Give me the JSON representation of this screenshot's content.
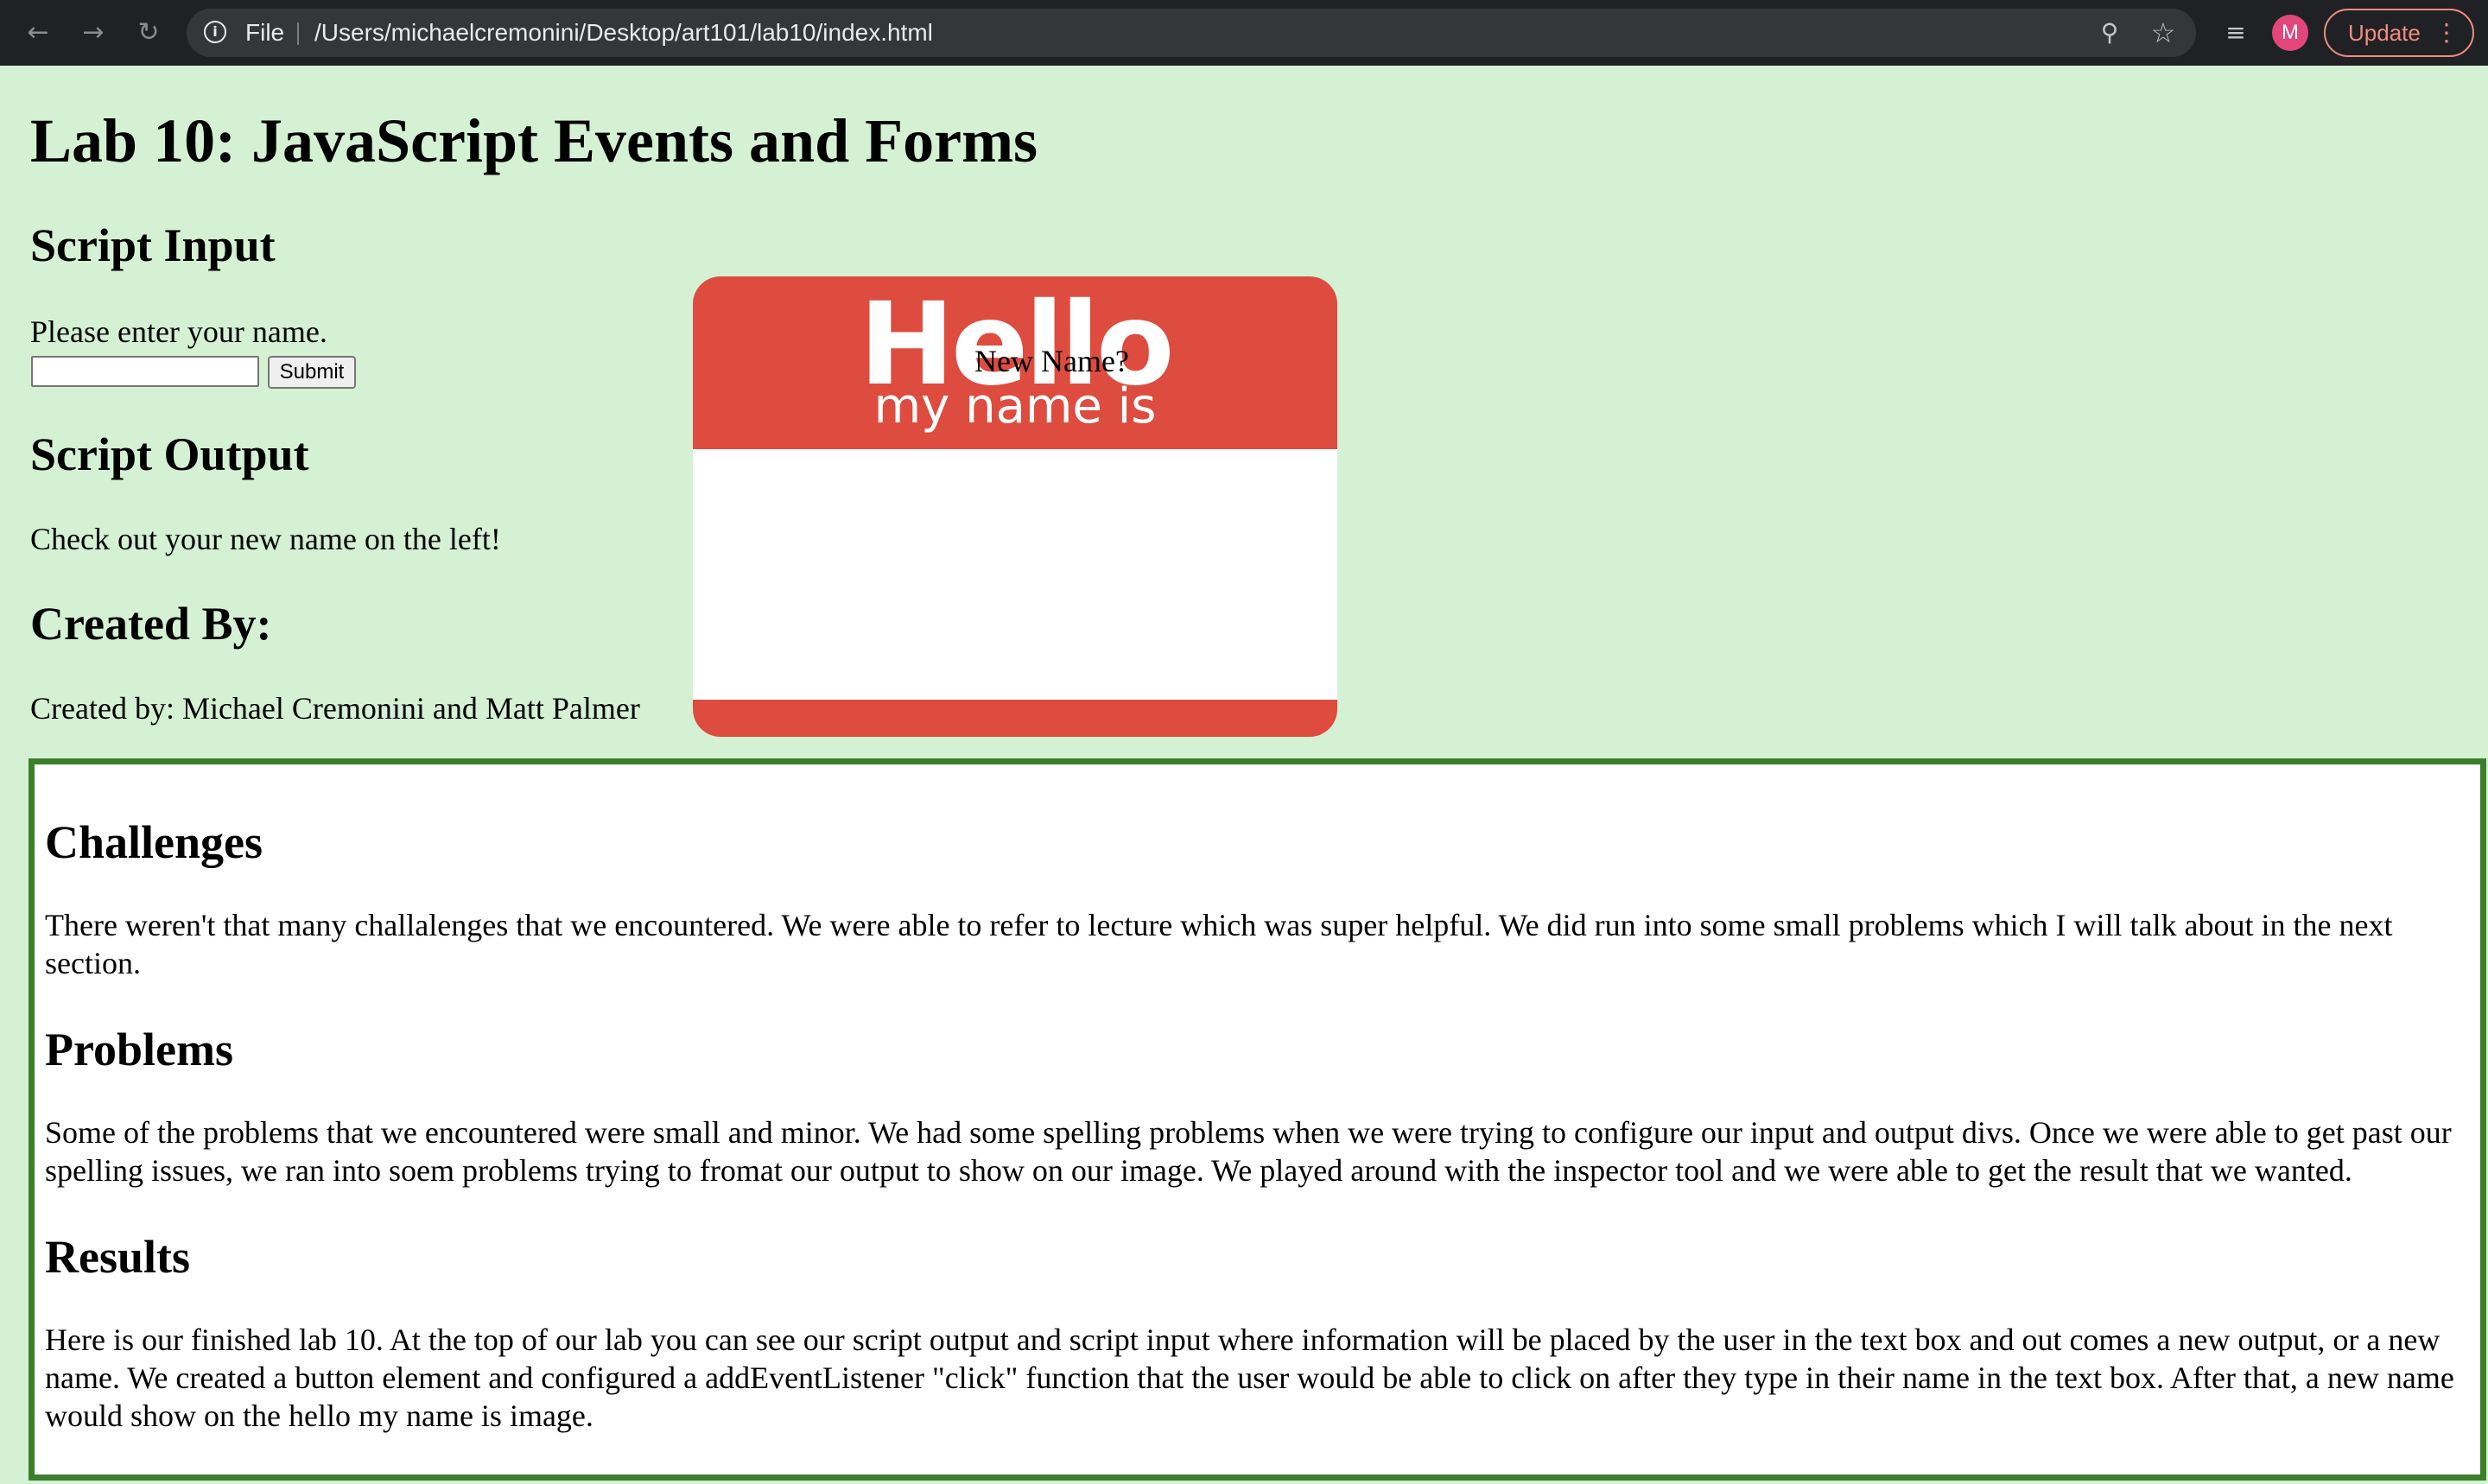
{
  "browser": {
    "scheme": "File",
    "url": "/Users/michaelcremonini/Desktop/art101/lab10/index.html",
    "avatar_letter": "M",
    "update_label": "Update"
  },
  "page": {
    "title": "Lab 10: JavaScript Events and Forms",
    "input_heading": "Script Input",
    "input_prompt": "Please enter your name.",
    "input_value": "",
    "submit_label": "Submit",
    "output_heading": "Script Output",
    "output_text": "Check out your new name on the left!",
    "created_heading": "Created By:",
    "created_text": "Created by: Michael Cremonini and Matt Palmer",
    "tag": {
      "hello": "Hello",
      "my_name_is": "my name is",
      "new_name": "New Name?",
      "colors": {
        "red": "#de4c3f",
        "white": "#ffffff"
      }
    },
    "sections": {
      "challenges_heading": "Challenges",
      "challenges_text": "There weren't that many challalenges that we encountered. We were able to refer to lecture which was super helpful. We did run into some small problems which I will talk about in the next section.",
      "problems_heading": "Problems",
      "problems_text": "Some of the problems that we encountered were small and minor. We had some spelling problems when we were trying to configure our input and output divs. Once we were able to get past our spelling issues, we ran into soem problems trying to fromat our output to show on our image. We played around with the inspector tool and we were able to get the result that we wanted.",
      "results_heading": "Results",
      "results_text": "Here is our finished lab 10. At the top of our lab you can see our script output and script input where information will be placed by the user in the text box and out comes a new output, or a new name. We created a button element and configured a addEventListener \"click\" function that the user would be able to click on after they type in their name in the text box. After that, a new name would show on the hello my name is image."
    },
    "colors": {
      "background": "#d5f1d4",
      "box_border": "#3b7f2a"
    }
  }
}
